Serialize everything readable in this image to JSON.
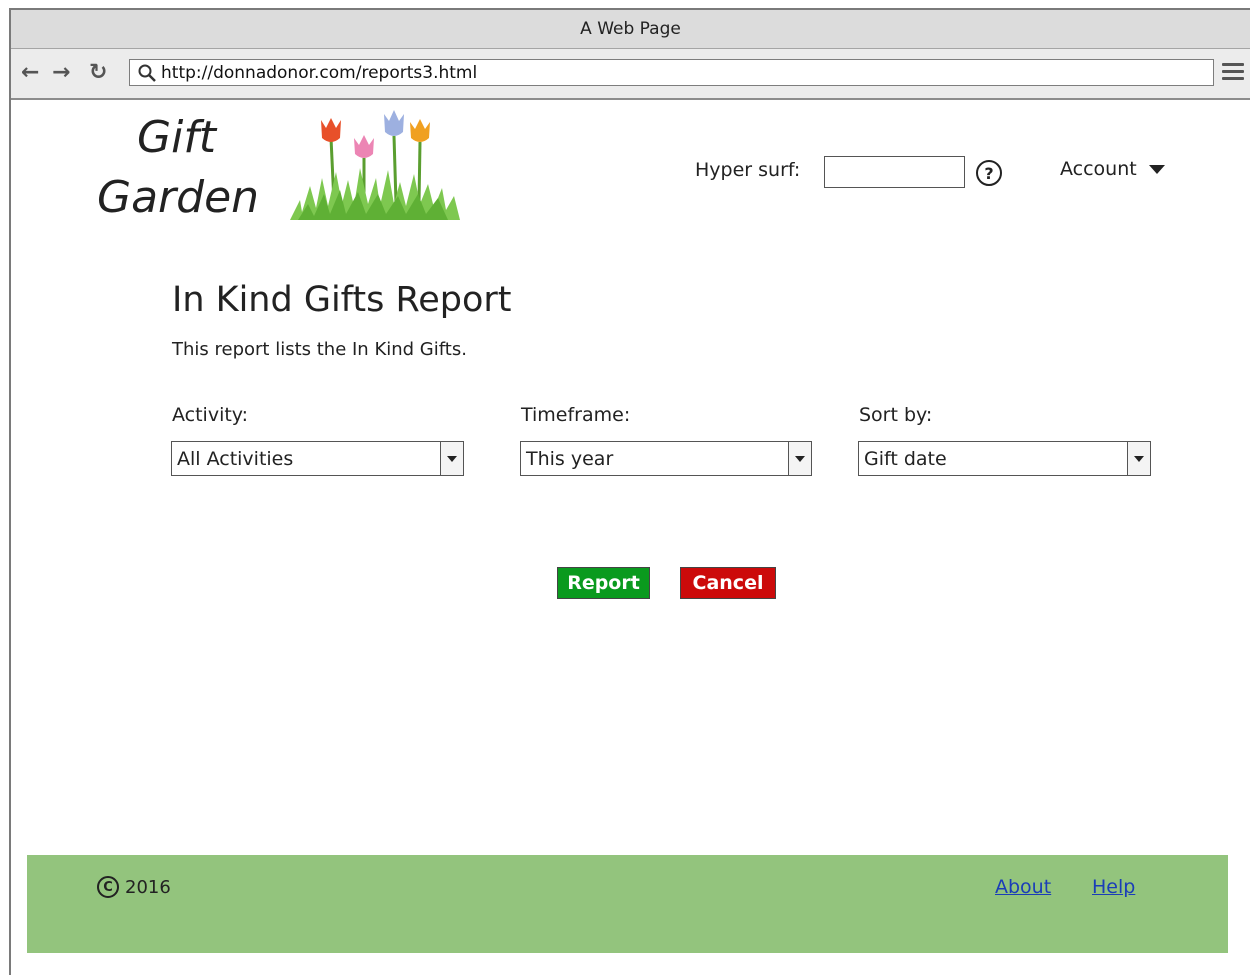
{
  "browser": {
    "title": "A Web Page",
    "url": "http://donnadonor.com/reports3.html"
  },
  "header": {
    "logo_line1": "Gift",
    "logo_line2": "Garden",
    "hypersurf_label": "Hyper surf:",
    "hypersurf_value": "",
    "help_symbol": "?",
    "account_label": "Account"
  },
  "main": {
    "title": "In Kind Gifts Report",
    "description": "This report lists the In Kind Gifts.",
    "filters": {
      "activity": {
        "label": "Activity:",
        "value": "All Activities"
      },
      "timeframe": {
        "label": "Timeframe:",
        "value": "This year"
      },
      "sort": {
        "label": "Sort by:",
        "value": "Gift date"
      }
    },
    "report_button": "Report",
    "cancel_button": "Cancel"
  },
  "footer": {
    "copyright_symbol": "C",
    "year": "2016",
    "about_link": "About",
    "help_link": "Help"
  },
  "colors": {
    "report_button": "#0a9a1e",
    "cancel_button": "#cc0a0a",
    "footer_bg": "#93c47d",
    "link": "#1a3db8"
  },
  "icons": [
    "back-arrow-icon",
    "forward-arrow-icon",
    "reload-icon",
    "search-icon",
    "hamburger-menu-icon",
    "tulips-logo-icon",
    "help-icon",
    "chevron-down-icon",
    "copyright-icon"
  ]
}
